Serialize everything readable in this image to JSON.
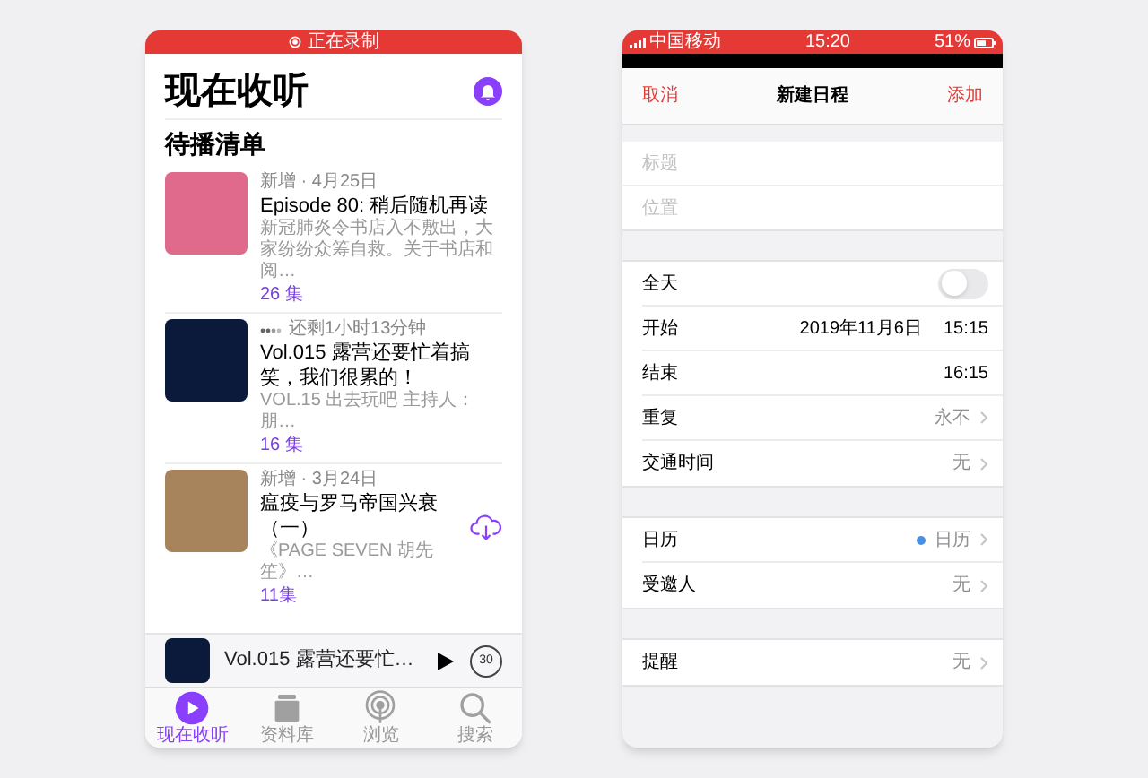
{
  "podcasts": {
    "status_bar": {
      "label": "正在录制"
    },
    "title": "现在收听",
    "section": "待播清单",
    "episodes": [
      {
        "meta": "新增 · 4月25日",
        "title": "Episode 80: 稍后随机再读",
        "description": "新冠肺炎令书店入不敷出，大家纷纷众筹自救。关于书店和阅…",
        "count": "26 集",
        "in_progress": false,
        "download": false,
        "color": "#e06a8c"
      },
      {
        "meta": "还剩1小时13分钟",
        "title": "Vol.015 露营还要忙着搞笑，我们很累的！",
        "description": "VOL.15 出去玩吧 主持人：朋…",
        "count": "16 集",
        "in_progress": true,
        "download": false,
        "color": "#0b1a3a"
      },
      {
        "meta": "新增 · 3月24日",
        "title": "瘟疫与罗马帝国兴衰（一）",
        "description": "《PAGE SEVEN 胡先笙》…",
        "count": "11集",
        "in_progress": false,
        "download": true,
        "color": "#a8845c"
      }
    ],
    "player": {
      "title": "Vol.015 露营还要忙…",
      "skip": "30"
    },
    "tabs": [
      {
        "label": "现在收听",
        "kind": "listen",
        "selected": true
      },
      {
        "label": "资料库",
        "kind": "library",
        "selected": false
      },
      {
        "label": "浏览",
        "kind": "browse",
        "selected": false
      },
      {
        "label": "搜索",
        "kind": "search",
        "selected": false
      }
    ]
  },
  "calendar": {
    "status_bar": {
      "carrier": "中国移动",
      "time": "15:20",
      "battery": "51%"
    },
    "header": {
      "cancel": "取消",
      "title": "新建日程",
      "add": "添加"
    },
    "sections": [
      {
        "rows": [
          {
            "kind": "input",
            "placeholder": "标题"
          },
          {
            "kind": "input",
            "placeholder": "位置"
          }
        ]
      },
      {
        "rows": [
          {
            "kind": "toggle",
            "label": "全天",
            "on": false
          },
          {
            "kind": "datetime",
            "label": "开始",
            "date": "2019年11月6日",
            "time": "15:15"
          },
          {
            "kind": "datetime",
            "label": "结束",
            "time": "16:15"
          },
          {
            "kind": "value",
            "label": "重复",
            "value": "永不"
          },
          {
            "kind": "value",
            "label": "交通时间",
            "value": "无"
          }
        ]
      },
      {
        "rows": [
          {
            "kind": "value",
            "label": "日历",
            "value": "日历",
            "color": "#4a90e2"
          },
          {
            "kind": "value",
            "label": "受邀人",
            "value": "无"
          }
        ]
      },
      {
        "rows": [
          {
            "kind": "value",
            "label": "提醒",
            "value": "无"
          }
        ]
      }
    ]
  }
}
